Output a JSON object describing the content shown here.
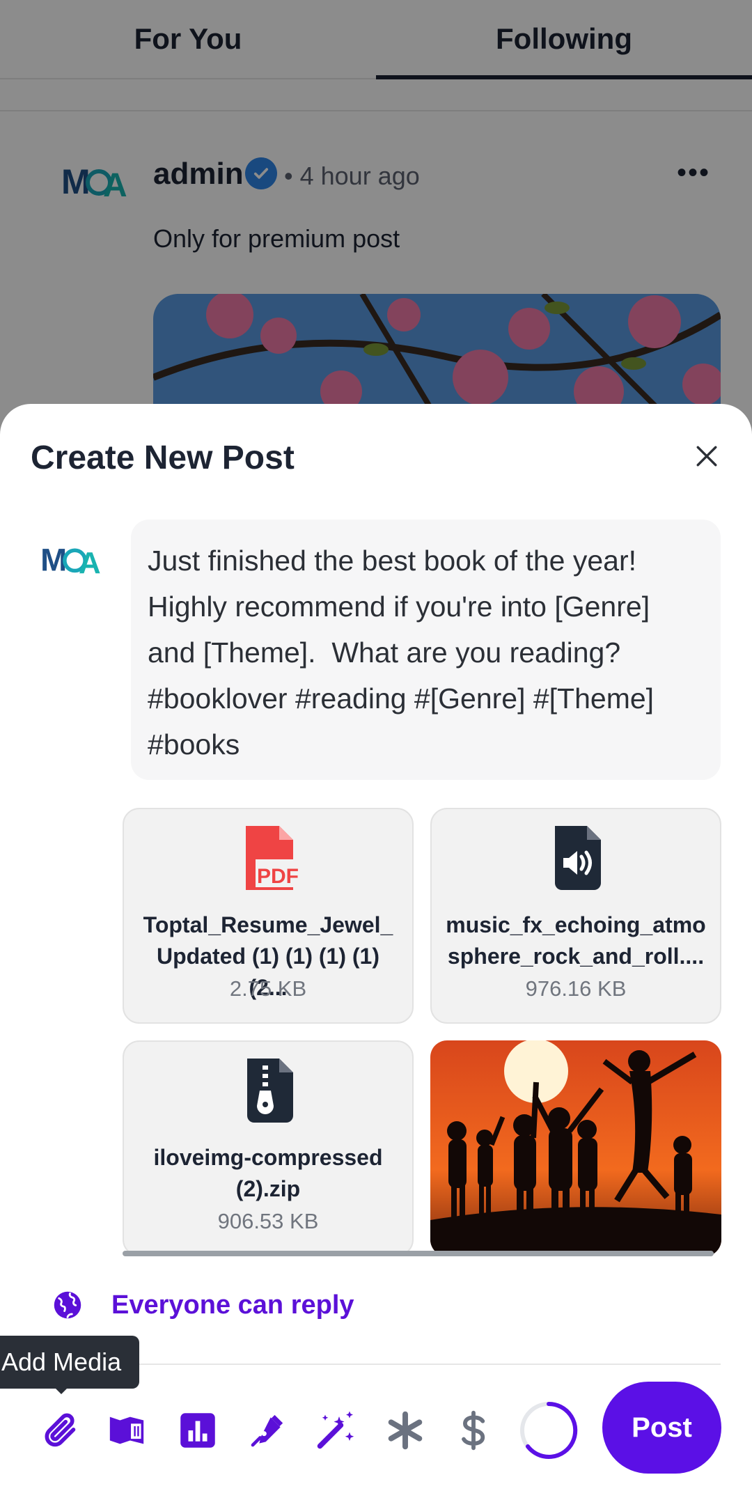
{
  "feed": {
    "tabs": [
      {
        "label": "For You",
        "active": false
      },
      {
        "label": "Following",
        "active": true
      }
    ],
    "post": {
      "author": "admin",
      "time": "• 4 hour ago",
      "text": "Only for premium post",
      "more_icon": "more-horizontal-icon"
    }
  },
  "sheet": {
    "title": "Create New Post",
    "close_icon": "close-icon",
    "composer_text": "Just finished the best book of the year! Highly recommend if you're into [Genre] and [Theme].  What are you reading? #booklover #reading #[Genre] #[Theme] #books",
    "attachments": [
      {
        "type": "pdf",
        "icon": "pdf-file-icon",
        "name": "Toptal_Resume_Jewel_Updated (1) (1) (1) (1) (2...",
        "size": "2.75 KB"
      },
      {
        "type": "audio",
        "icon": "audio-file-icon",
        "name": "music_fx_echoing_atmosphere_rock_and_roll....",
        "size": "976.16 KB"
      },
      {
        "type": "zip",
        "icon": "zip-file-icon",
        "name": "iloveimg-compressed (2).zip",
        "size": "906.53 KB"
      },
      {
        "type": "image",
        "icon": "image-thumbnail"
      }
    ],
    "reply_setting": "Everyone can reply",
    "tooltip": "Add Media",
    "post_button": "Post",
    "toolbar_icons": [
      "attach-icon",
      "media-gallery-icon",
      "poll-icon",
      "draw-icon",
      "ai-magic-icon",
      "asterisk-icon",
      "dollar-icon"
    ],
    "colors": {
      "accent": "#5b10e6",
      "pdf": "#ef4444",
      "file_dark": "#1f2937"
    }
  }
}
